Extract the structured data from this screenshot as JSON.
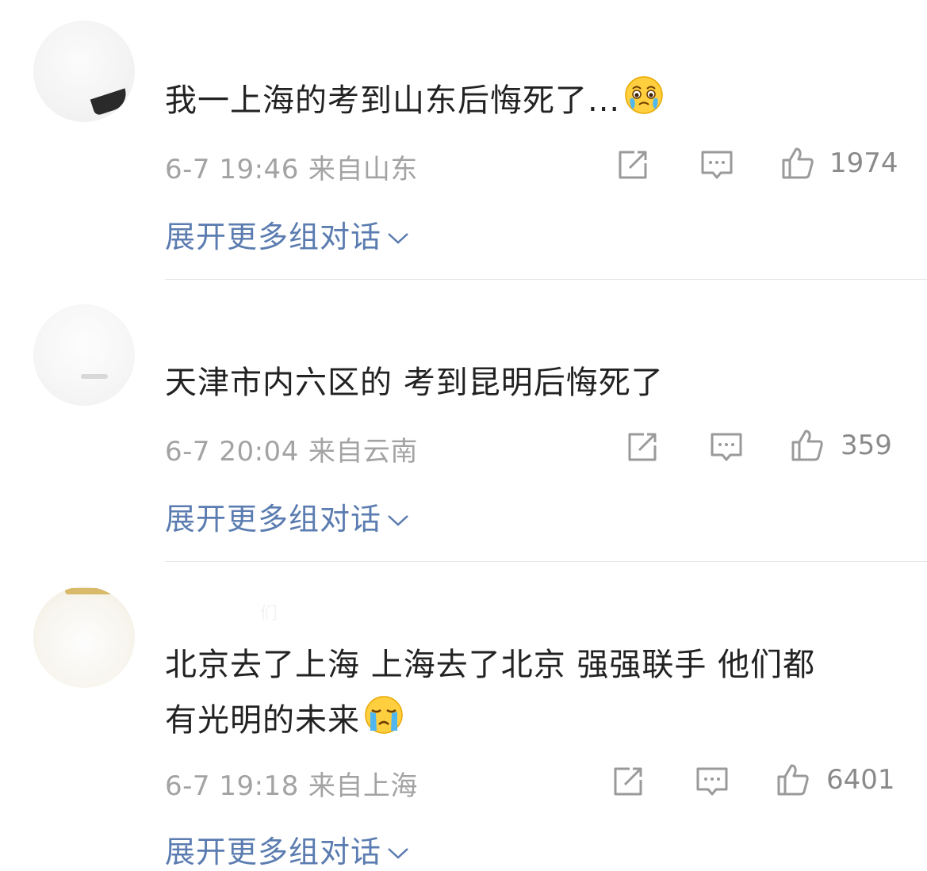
{
  "comments": [
    {
      "username": "",
      "text": "我一上海的考到山东后悔死了...",
      "emoji": "crying-face-emoji",
      "time": "6-7 19:46",
      "location": "来自山东",
      "likes": "1974",
      "expand_label": "展开更多组对话"
    },
    {
      "username": "",
      "text": "天津市内六区的 考到昆明后悔死了",
      "emoji": "",
      "time": "6-7 20:04",
      "location": "来自云南",
      "likes": "359",
      "expand_label": "展开更多组对话"
    },
    {
      "username": "们",
      "text_line1": "北京去了上海 上海去了北京 强强联手 他们都",
      "text_line2": "有光明的未来",
      "emoji": "loudly-crying-face-emoji",
      "time": "6-7 19:18",
      "location": "来自上海",
      "likes": "6401",
      "expand_label": "展开更多组对话"
    }
  ],
  "colors": {
    "text": "#222222",
    "meta": "#a3a3a3",
    "link": "#5b7cb0",
    "icon": "#9a9a9a",
    "divider": "#e6e6e6"
  }
}
